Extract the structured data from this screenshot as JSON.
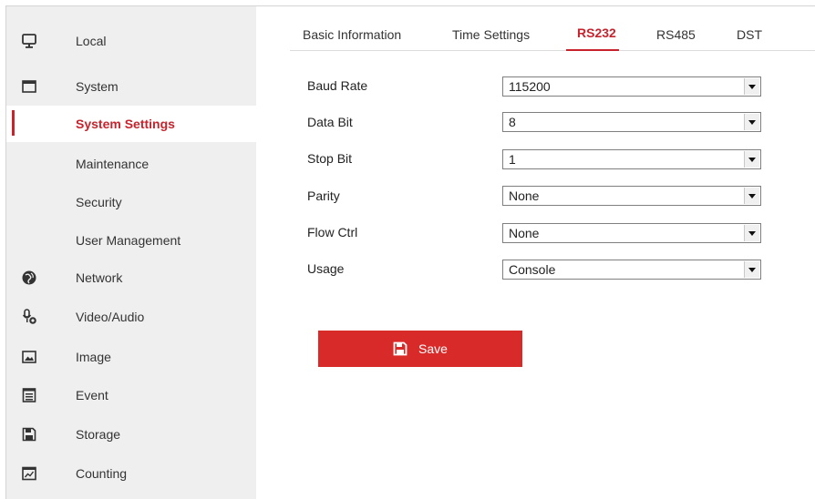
{
  "sidebar": {
    "items": [
      {
        "label": "Local",
        "icon": "monitor-icon"
      },
      {
        "label": "System",
        "icon": "window-icon"
      },
      {
        "label": "System Settings",
        "active": true
      },
      {
        "label": "Maintenance"
      },
      {
        "label": "Security"
      },
      {
        "label": "User Management"
      },
      {
        "label": "Network",
        "icon": "globe-icon"
      },
      {
        "label": "Video/Audio",
        "icon": "microphone-camera-icon"
      },
      {
        "label": "Image",
        "icon": "image-icon"
      },
      {
        "label": "Event",
        "icon": "event-list-icon"
      },
      {
        "label": "Storage",
        "icon": "floppy-icon"
      },
      {
        "label": "Counting",
        "icon": "counting-chart-icon"
      }
    ]
  },
  "tabs": [
    {
      "label": "Basic Information"
    },
    {
      "label": "Time Settings"
    },
    {
      "label": "RS232",
      "active": true
    },
    {
      "label": "RS485"
    },
    {
      "label": "DST"
    }
  ],
  "form": {
    "fields": [
      {
        "label": "Baud Rate",
        "value": "115200"
      },
      {
        "label": "Data Bit",
        "value": "8"
      },
      {
        "label": "Stop Bit",
        "value": "1"
      },
      {
        "label": "Parity",
        "value": "None"
      },
      {
        "label": "Flow Ctrl",
        "value": "None"
      },
      {
        "label": "Usage",
        "value": "Console"
      }
    ]
  },
  "save_button": {
    "label": "Save",
    "icon": "floppy-icon"
  },
  "colors": {
    "accent": "#c8232c",
    "save_bg": "#d92a2a",
    "sidebar_bg": "#efefef"
  }
}
